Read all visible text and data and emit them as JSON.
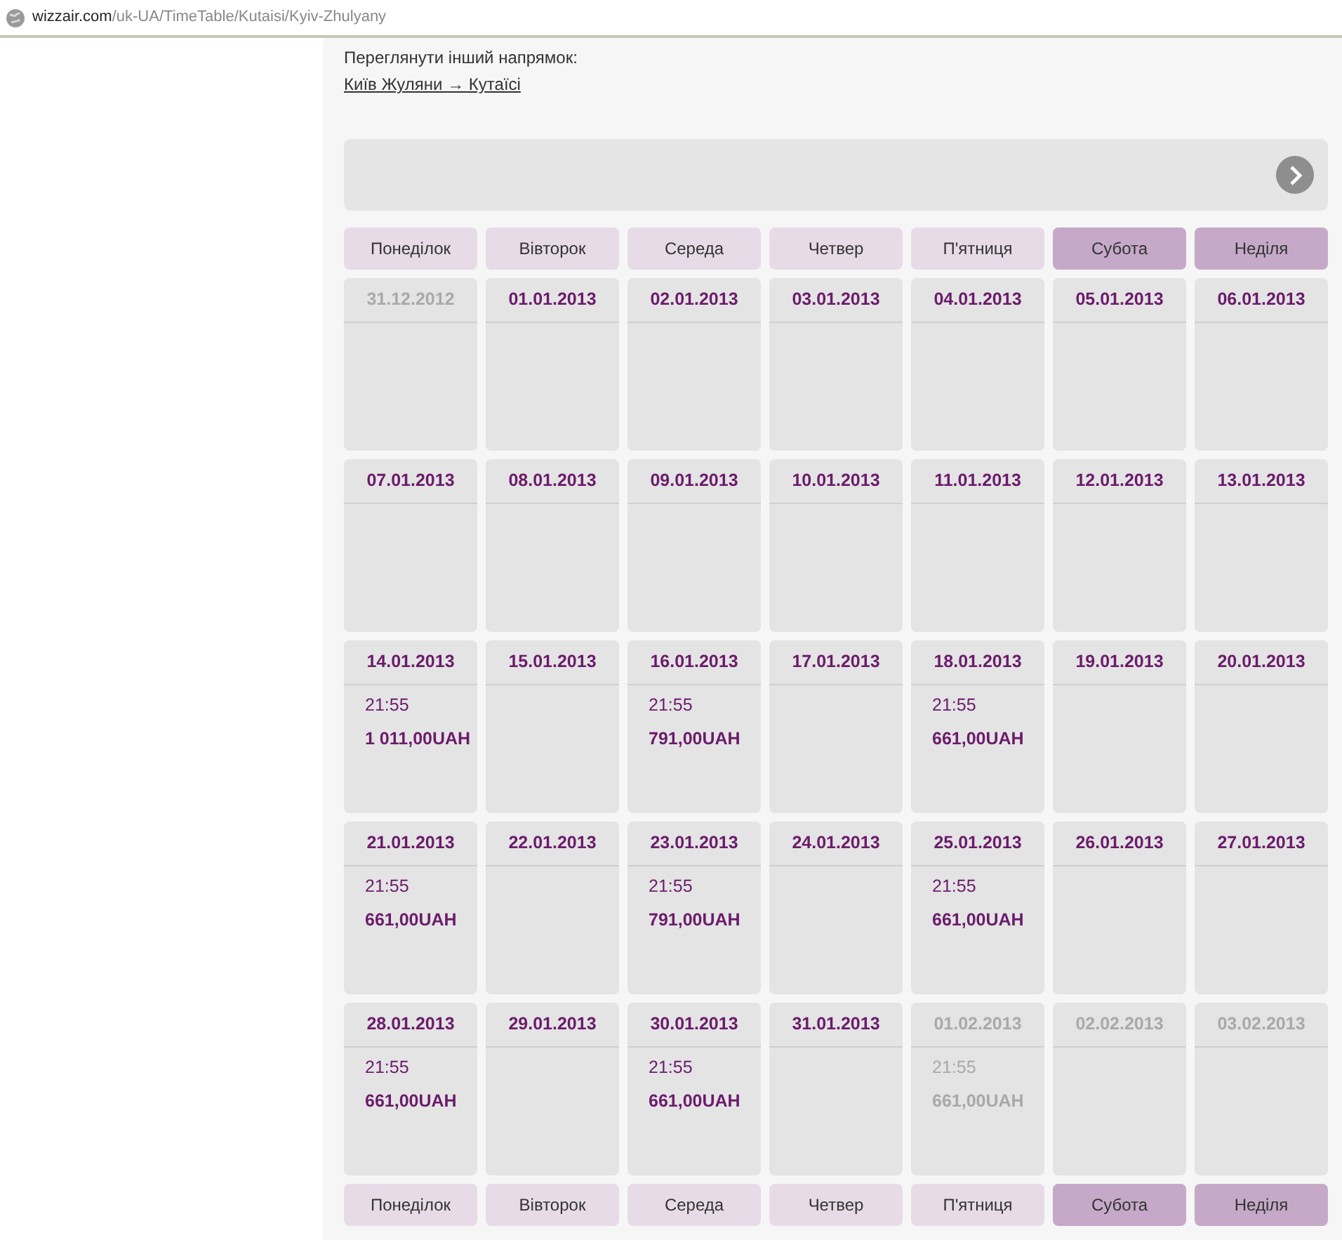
{
  "address_bar": {
    "domain": "wizzair.com",
    "path": "/uk-UA/TimeTable/Kutaisi/Kyiv-Zhulyany"
  },
  "other_direction": {
    "label": "Переглянути інший напрямок:",
    "link": "Київ Жуляни → Кутаїсі"
  },
  "weekdays": [
    {
      "label": "Понеділок",
      "weekend": false
    },
    {
      "label": "Вівторок",
      "weekend": false
    },
    {
      "label": "Середа",
      "weekend": false
    },
    {
      "label": "Четвер",
      "weekend": false
    },
    {
      "label": "П'ятниця",
      "weekend": false
    },
    {
      "label": "Субота",
      "weekend": true
    },
    {
      "label": "Неділя",
      "weekend": true
    }
  ],
  "weeks": [
    [
      {
        "date": "31.12.2012",
        "in_month": false
      },
      {
        "date": "01.01.2013",
        "in_month": true
      },
      {
        "date": "02.01.2013",
        "in_month": true
      },
      {
        "date": "03.01.2013",
        "in_month": true
      },
      {
        "date": "04.01.2013",
        "in_month": true
      },
      {
        "date": "05.01.2013",
        "in_month": true
      },
      {
        "date": "06.01.2013",
        "in_month": true
      }
    ],
    [
      {
        "date": "07.01.2013",
        "in_month": true
      },
      {
        "date": "08.01.2013",
        "in_month": true
      },
      {
        "date": "09.01.2013",
        "in_month": true
      },
      {
        "date": "10.01.2013",
        "in_month": true
      },
      {
        "date": "11.01.2013",
        "in_month": true
      },
      {
        "date": "12.01.2013",
        "in_month": true
      },
      {
        "date": "13.01.2013",
        "in_month": true
      }
    ],
    [
      {
        "date": "14.01.2013",
        "in_month": true,
        "time": "21:55",
        "price": "1 011,00UAH"
      },
      {
        "date": "15.01.2013",
        "in_month": true
      },
      {
        "date": "16.01.2013",
        "in_month": true,
        "time": "21:55",
        "price": "791,00UAH"
      },
      {
        "date": "17.01.2013",
        "in_month": true
      },
      {
        "date": "18.01.2013",
        "in_month": true,
        "time": "21:55",
        "price": "661,00UAH"
      },
      {
        "date": "19.01.2013",
        "in_month": true
      },
      {
        "date": "20.01.2013",
        "in_month": true
      }
    ],
    [
      {
        "date": "21.01.2013",
        "in_month": true,
        "time": "21:55",
        "price": "661,00UAH"
      },
      {
        "date": "22.01.2013",
        "in_month": true
      },
      {
        "date": "23.01.2013",
        "in_month": true,
        "time": "21:55",
        "price": "791,00UAH"
      },
      {
        "date": "24.01.2013",
        "in_month": true
      },
      {
        "date": "25.01.2013",
        "in_month": true,
        "time": "21:55",
        "price": "661,00UAH"
      },
      {
        "date": "26.01.2013",
        "in_month": true
      },
      {
        "date": "27.01.2013",
        "in_month": true
      }
    ],
    [
      {
        "date": "28.01.2013",
        "in_month": true,
        "time": "21:55",
        "price": "661,00UAH"
      },
      {
        "date": "29.01.2013",
        "in_month": true
      },
      {
        "date": "30.01.2013",
        "in_month": true,
        "time": "21:55",
        "price": "661,00UAH"
      },
      {
        "date": "31.01.2013",
        "in_month": true
      },
      {
        "date": "01.02.2013",
        "in_month": false,
        "time": "21:55",
        "price": "661,00UAH"
      },
      {
        "date": "02.02.2013",
        "in_month": false
      },
      {
        "date": "03.02.2013",
        "in_month": false
      }
    ]
  ],
  "weekdays_footer": [
    {
      "label": "Понеділок",
      "weekend": false
    },
    {
      "label": "Вівторок",
      "weekend": false
    },
    {
      "label": "Середа",
      "weekend": false
    },
    {
      "label": "Четвер",
      "weekend": false
    },
    {
      "label": "П'ятниця",
      "weekend": false
    },
    {
      "label": "Субота",
      "weekend": true
    },
    {
      "label": "Неділя",
      "weekend": true
    }
  ]
}
